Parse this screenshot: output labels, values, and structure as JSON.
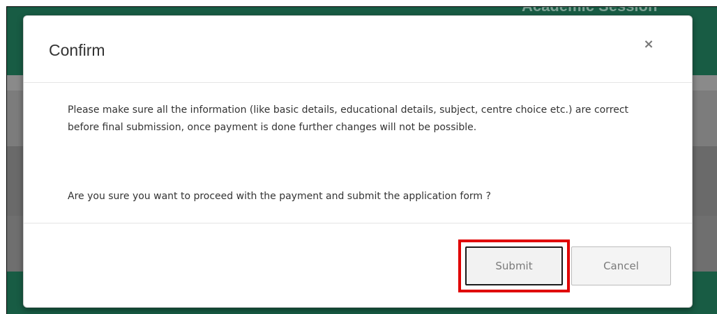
{
  "modal": {
    "title": "Confirm",
    "close_symbol": "×",
    "body": {
      "paragraph1": "Please make sure all the information (like basic details, educational details, subject, centre choice etc.) are correct before final submission, once payment is done further changes will not be possible.",
      "paragraph2": "Are you sure you want to proceed with the payment and submit the application form ?"
    },
    "buttons": {
      "submit_label": "Submit",
      "cancel_label": "Cancel"
    }
  },
  "background": {
    "header_text": "Academic Session"
  },
  "colors": {
    "header_green": "#185c44",
    "highlight_red": "#e00000",
    "overlay_gray": "#6f6f6f"
  },
  "icons": {
    "close": "close-icon"
  }
}
